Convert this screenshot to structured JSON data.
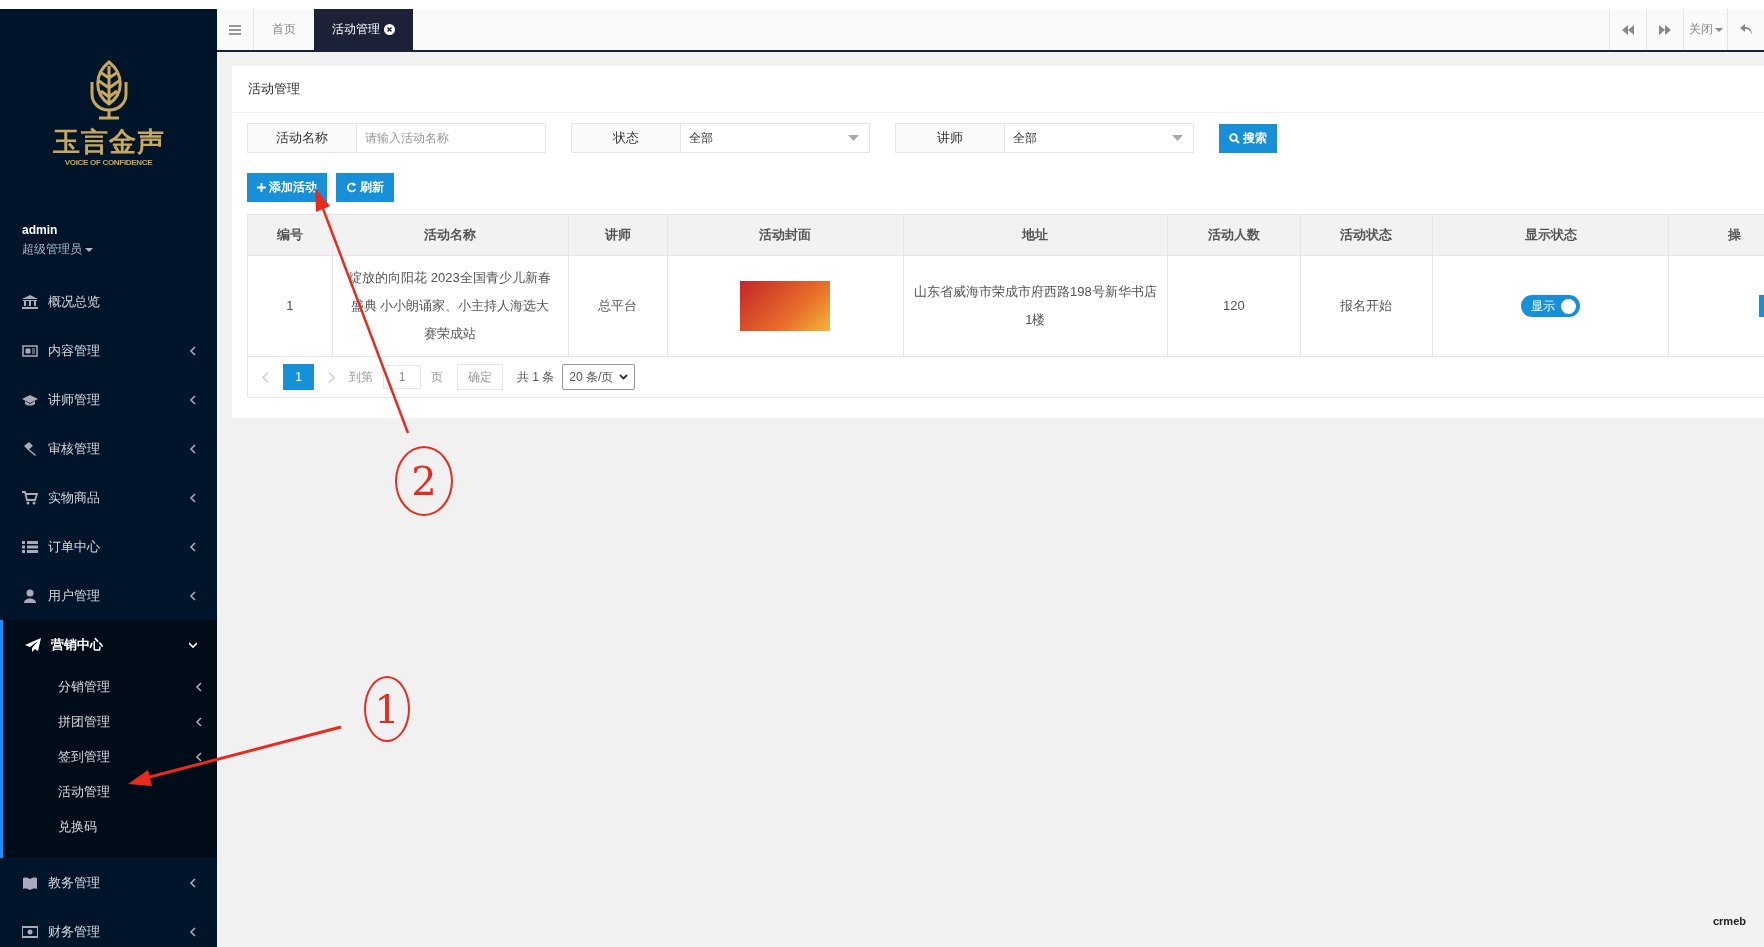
{
  "brand": {
    "name": "玉言金声",
    "tagline": "VOICE OF CONFIDENCE"
  },
  "user": {
    "name": "admin",
    "role": "超级管理员"
  },
  "sidebar": {
    "items": [
      {
        "label": "概况总览",
        "has_arrow": false,
        "expanded": false
      },
      {
        "label": "内容管理",
        "has_arrow": true,
        "expanded": false
      },
      {
        "label": "讲师管理",
        "has_arrow": true,
        "expanded": false
      },
      {
        "label": "审核管理",
        "has_arrow": true,
        "expanded": false
      },
      {
        "label": "实物商品",
        "has_arrow": true,
        "expanded": false
      },
      {
        "label": "订单中心",
        "has_arrow": true,
        "expanded": false
      },
      {
        "label": "用户管理",
        "has_arrow": true,
        "expanded": false
      },
      {
        "label": "营销中心",
        "has_arrow": true,
        "expanded": true,
        "children": [
          {
            "label": "分销管理",
            "has_arrow": true
          },
          {
            "label": "拼团管理",
            "has_arrow": true
          },
          {
            "label": "签到管理",
            "has_arrow": true
          },
          {
            "label": "活动管理",
            "has_arrow": false
          },
          {
            "label": "兑换码",
            "has_arrow": false
          }
        ]
      },
      {
        "label": "教务管理",
        "has_arrow": true,
        "expanded": false
      },
      {
        "label": "财务管理",
        "has_arrow": true,
        "expanded": false
      }
    ]
  },
  "tabs": [
    {
      "label": "首页",
      "selected": false
    },
    {
      "label": "活动管理",
      "selected": true
    }
  ],
  "toolbar": {
    "close_menu": "关闭"
  },
  "panel": {
    "title": "活动管理"
  },
  "filters": [
    {
      "kind": "input",
      "label": "活动名称",
      "placeholder": "请输入活动名称"
    },
    {
      "kind": "select",
      "label": "状态",
      "value": "全部"
    },
    {
      "kind": "select",
      "label": "讲师",
      "value": "全部"
    }
  ],
  "search_button": "搜索",
  "actions": [
    "添加活动",
    "刷新"
  ],
  "table": {
    "columns": [
      "编号",
      "活动名称",
      "讲师",
      "活动封面",
      "地址",
      "活动人数",
      "活动状态",
      "显示状态",
      "操"
    ],
    "rows": [
      {
        "id": "1",
        "name": "绽放的向阳花 2023全国青少儿新春盛典 小小朗诵家、小主持人海选大赛荣成站",
        "teacher": "总平台",
        "address": "山东省威海市荣成市府西路198号新华书店1楼",
        "people": "120",
        "status": "报名开始",
        "display": {
          "label": "显示",
          "on": true
        }
      }
    ]
  },
  "pagination": {
    "pages": [
      {
        "label": "1",
        "selected": true
      }
    ],
    "goto_label": "到第",
    "goto_value": "1",
    "page_unit": "页",
    "confirm": "确定",
    "total": "共 1 条",
    "page_size": "20 条/页"
  },
  "footer_logo": "crmeb",
  "annotations": [
    {
      "number": "2"
    },
    {
      "number": "1"
    }
  ]
}
